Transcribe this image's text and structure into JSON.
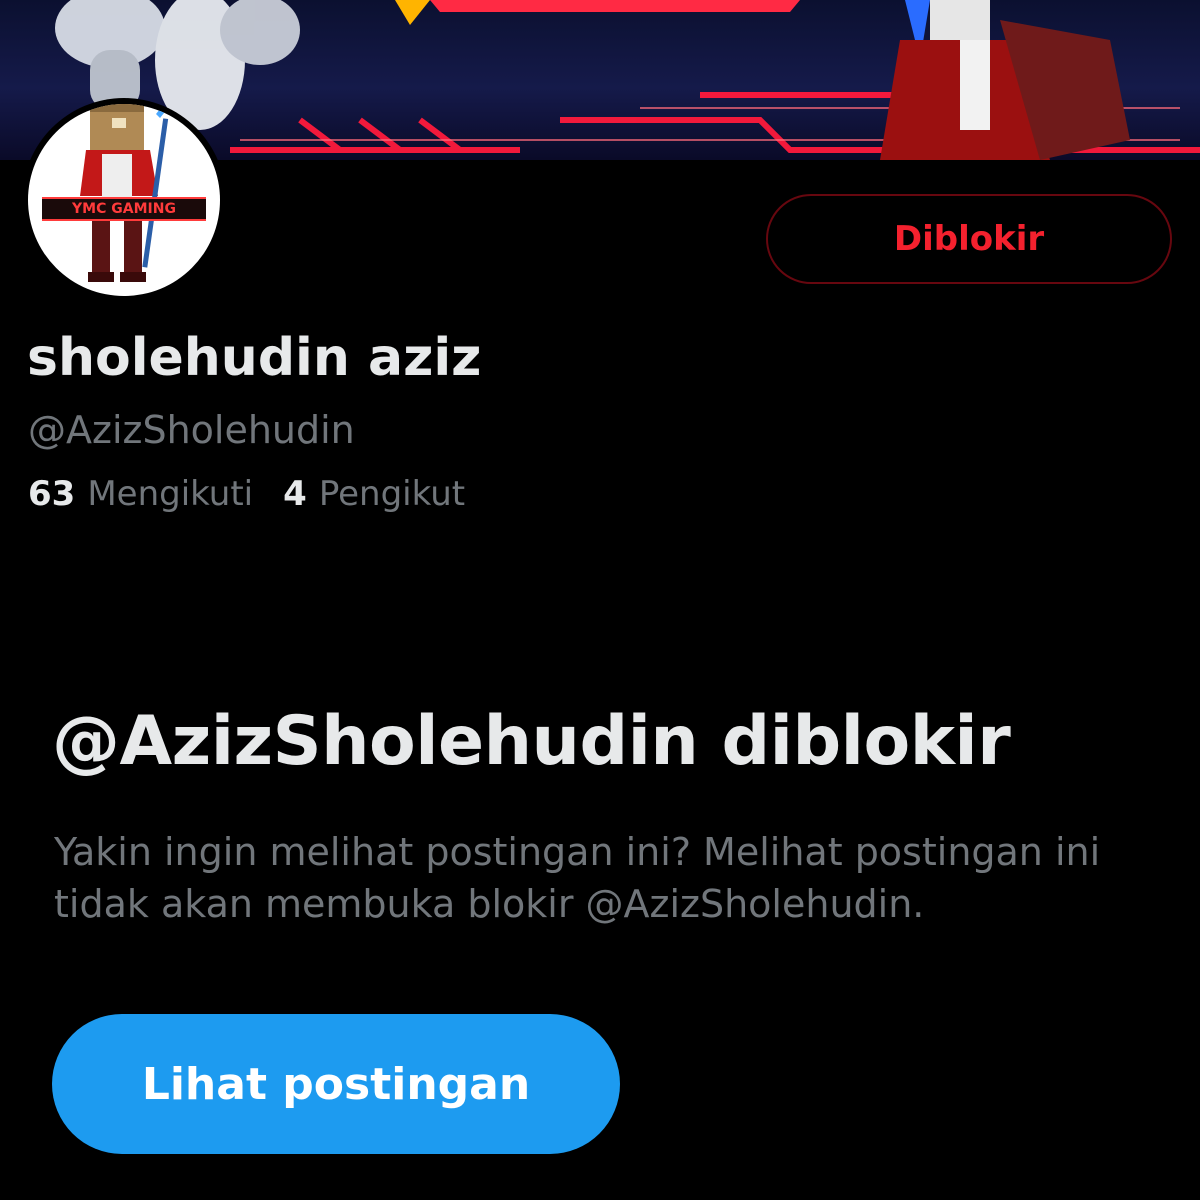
{
  "banner": {
    "description_icon": "banner-image",
    "accent_colors": [
      "#ff1a3c",
      "#0b1030",
      "#ffb400"
    ]
  },
  "avatar": {
    "logo_text": "YMC GAMING"
  },
  "profile": {
    "blocked_button_label": "Diblokir",
    "display_name": "sholehudin aziz",
    "handle": "@AzizSholehudin",
    "following_count": "63",
    "following_label": "Mengikuti",
    "followers_count": "4",
    "followers_label": "Pengikut"
  },
  "blocked_notice": {
    "title": "@AzizSholehudin diblokir",
    "description": "Yakin ingin melihat postingan ini? Melihat postingan ini tidak akan membuka blokir @AzizSholehudin.",
    "view_button_label": "Lihat postingan"
  },
  "colors": {
    "background": "#000000",
    "text_primary": "#e7e9ea",
    "text_secondary": "#71767b",
    "blocked_red": "#f4212e",
    "primary_blue": "#1d9bf0"
  }
}
